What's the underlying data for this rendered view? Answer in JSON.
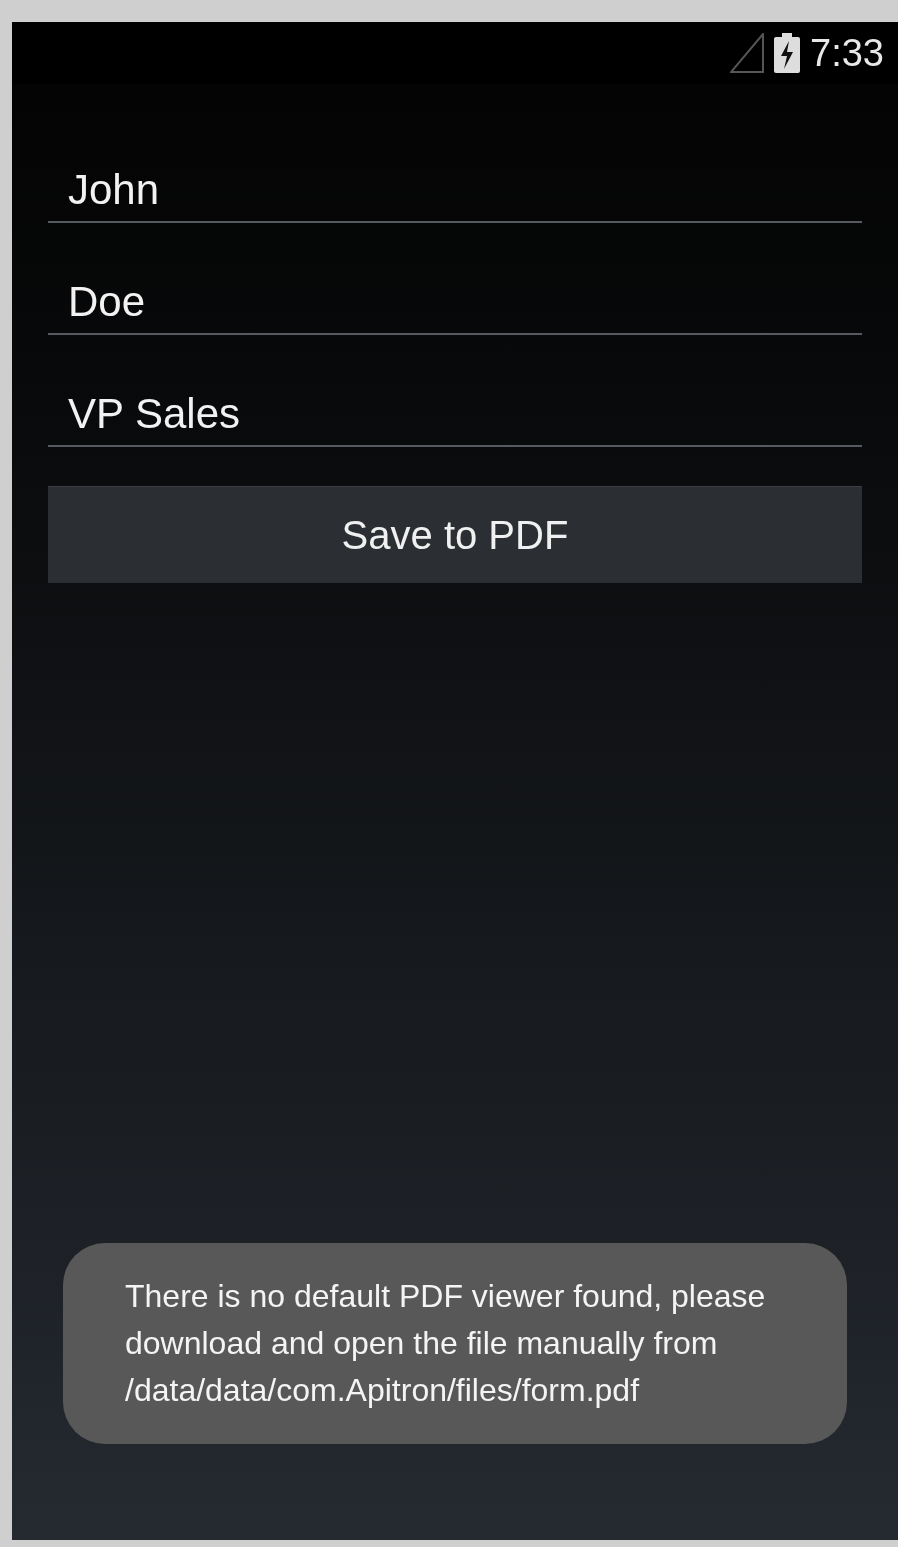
{
  "status_bar": {
    "time": "7:33",
    "charging": true
  },
  "fields": [
    {
      "value": "John"
    },
    {
      "value": "Doe"
    },
    {
      "value": "VP Sales"
    }
  ],
  "button": {
    "label": "Save to PDF"
  },
  "toast": {
    "message": "There is no default PDF viewer found, please download and open the file manually from /data/data/com.Apitron/files/form.pdf"
  }
}
